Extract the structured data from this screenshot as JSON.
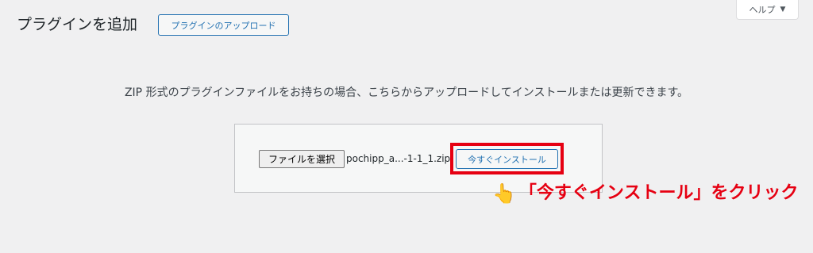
{
  "header": {
    "title": "プラグインを追加",
    "upload_button": "プラグインのアップロード",
    "help_tab": "ヘルプ",
    "help_caret": "▼"
  },
  "upload": {
    "description": "ZIP 形式のプラグインファイルをお持ちの場合、こちらからアップロードしてインストールまたは更新できます。",
    "choose_file_label": "ファイルを選択",
    "file_name": "pochipp_a...-1-1_1.zip",
    "install_button": "今すぐインストール"
  },
  "annotation": {
    "hand_icon": "pointing-hand-icon",
    "hand_glyph": "👆",
    "text": "「今すぐインストール」をクリック",
    "highlight_color": "#e60012"
  }
}
